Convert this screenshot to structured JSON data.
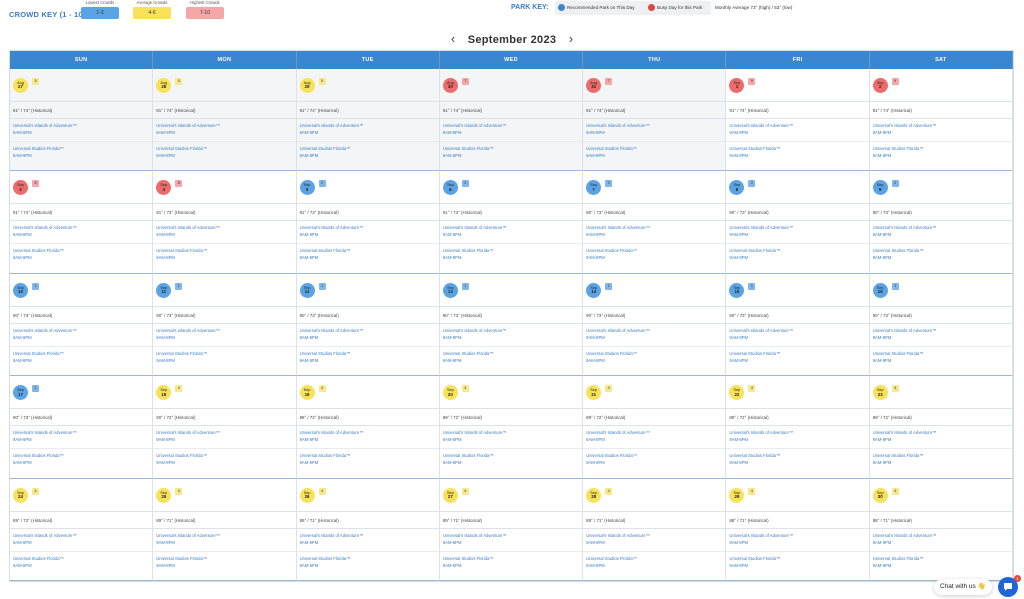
{
  "crowd_key": {
    "title": "CROWD KEY (1 - 10):",
    "items": [
      {
        "label": "Lowest Crowds",
        "range": "1-3",
        "color": "#5aa3e4"
      },
      {
        "label": "Average Crowds",
        "range": "4-6",
        "color": "#f7e25a"
      },
      {
        "label": "Highest Crowds",
        "range": "7-10",
        "color": "#f5a6a6"
      }
    ]
  },
  "park_key": {
    "title": "PARK KEY:",
    "recommended": "Recommended Park on This Day",
    "busy": "Busy Day for this Park",
    "monthly_avg": "Monthly Average 73° (high) / 53° (low)"
  },
  "month_nav": {
    "title": "September 2023",
    "prev": "‹",
    "next": "›"
  },
  "calendar": {
    "days": [
      "SUN",
      "MON",
      "TUE",
      "WED",
      "THU",
      "FRI",
      "SAT"
    ],
    "park_names": [
      "Universal's Islands of Adventure™",
      "Universal Studios Florida™"
    ],
    "weeks": [
      [
        {
          "month": "Aug",
          "day": "27",
          "crowd": "5",
          "level": "avg",
          "weather": "91° / 74° (Historical)",
          "past": true,
          "hours": [
            "9AM-8PM",
            "9AM-8PM"
          ]
        },
        {
          "month": "Aug",
          "day": "28",
          "crowd": "5",
          "level": "avg",
          "weather": "91° / 74° (Historical)",
          "past": true,
          "hours": [
            "9AM-8PM",
            "9AM-8PM"
          ]
        },
        {
          "month": "Aug",
          "day": "29",
          "crowd": "5",
          "level": "avg",
          "weather": "91° / 74° (Historical)",
          "past": true,
          "hours": [
            "9AM-8PM",
            "9AM-8PM"
          ]
        },
        {
          "month": "Aug",
          "day": "30",
          "crowd": "7",
          "level": "high",
          "weather": "91° / 74° (Historical)",
          "past": true,
          "hours": [
            "9AM-8PM",
            "9AM-8PM"
          ]
        },
        {
          "month": "Aug",
          "day": "31",
          "crowd": "7",
          "level": "high",
          "weather": "91° / 74° (Historical)",
          "past": true,
          "hours": [
            "9AM-8PM",
            "9AM-8PM"
          ]
        },
        {
          "month": "Sep",
          "day": "1",
          "crowd": "9",
          "level": "high",
          "weather": "91° / 74° (Historical)",
          "past": false,
          "hours": [
            "9AM-8PM",
            "9AM-8PM"
          ]
        },
        {
          "month": "Sep",
          "day": "2",
          "crowd": "9",
          "level": "high",
          "weather": "91° / 74° (Historical)",
          "past": false,
          "hours": [
            "9AM-8PM",
            "9AM-8PM"
          ]
        }
      ],
      [
        {
          "month": "Sep",
          "day": "3",
          "crowd": "8",
          "level": "high",
          "weather": "91° / 74° (Historical)",
          "past": false,
          "hours": [
            "9AM-8PM",
            "9AM-8PM"
          ]
        },
        {
          "month": "Sep",
          "day": "4",
          "crowd": "8",
          "level": "high",
          "weather": "91° / 73° (Historical)",
          "past": false,
          "hours": [
            "9AM-8PM",
            "9AM-8PM"
          ]
        },
        {
          "month": "Sep",
          "day": "5",
          "crowd": "2",
          "level": "low",
          "weather": "91° / 73° (Historical)",
          "past": false,
          "hours": [
            "9AM-8PM",
            "9AM-8PM"
          ]
        },
        {
          "month": "Sep",
          "day": "6",
          "crowd": "2",
          "level": "low",
          "weather": "91° / 73° (Historical)",
          "past": false,
          "hours": [
            "9AM-8PM",
            "9AM-8PM"
          ]
        },
        {
          "month": "Sep",
          "day": "7",
          "crowd": "2",
          "level": "low",
          "weather": "90° / 73° (Historical)",
          "past": false,
          "hours": [
            "9AM-8PM",
            "9AM-8PM"
          ]
        },
        {
          "month": "Sep",
          "day": "8",
          "crowd": "2",
          "level": "low",
          "weather": "90° / 73° (Historical)",
          "past": false,
          "hours": [
            "9AM-8PM",
            "9AM-8PM"
          ]
        },
        {
          "month": "Sep",
          "day": "9",
          "crowd": "2",
          "level": "low",
          "weather": "90° / 73° (Historical)",
          "past": false,
          "hours": [
            "9AM-8PM",
            "9AM-8PM"
          ]
        }
      ],
      [
        {
          "month": "Sep",
          "day": "10",
          "crowd": "1",
          "level": "low",
          "weather": "90° / 73° (Historical)",
          "past": false,
          "hours": [
            "9AM-8PM",
            "9AM-8PM"
          ]
        },
        {
          "month": "Sep",
          "day": "11",
          "crowd": "1",
          "level": "low",
          "weather": "90° / 73° (Historical)",
          "past": false,
          "hours": [
            "9AM-8PM",
            "9AM-8PM"
          ]
        },
        {
          "month": "Sep",
          "day": "12",
          "crowd": "1",
          "level": "low",
          "weather": "90° / 73° (Historical)",
          "past": false,
          "hours": [
            "9AM-8PM",
            "9AM-8PM"
          ]
        },
        {
          "month": "Sep",
          "day": "13",
          "crowd": "1",
          "level": "low",
          "weather": "90° / 73° (Historical)",
          "past": false,
          "hours": [
            "9AM-8PM",
            "9AM-8PM"
          ]
        },
        {
          "month": "Sep",
          "day": "14",
          "crowd": "1",
          "level": "low",
          "weather": "90° / 73° (Historical)",
          "past": false,
          "hours": [
            "9AM-8PM",
            "9AM-8PM"
          ]
        },
        {
          "month": "Sep",
          "day": "15",
          "crowd": "1",
          "level": "low",
          "weather": "90° / 73° (Historical)",
          "past": false,
          "hours": [
            "9AM-8PM",
            "9AM-8PM"
          ]
        },
        {
          "month": "Sep",
          "day": "16",
          "crowd": "1",
          "level": "low",
          "weather": "90° / 73° (Historical)",
          "past": false,
          "hours": [
            "9AM-8PM",
            "9AM-8PM"
          ]
        }
      ],
      [
        {
          "month": "Sep",
          "day": "17",
          "crowd": "1",
          "level": "low",
          "weather": "90° / 73° (Historical)",
          "past": false,
          "hours": [
            "9AM-8PM",
            "9AM-8PM"
          ]
        },
        {
          "month": "Sep",
          "day": "18",
          "crowd": "4",
          "level": "avg",
          "weather": "90° / 72° (Historical)",
          "past": false,
          "hours": [
            "9AM-8PM",
            "9AM-8PM"
          ]
        },
        {
          "month": "Sep",
          "day": "19",
          "crowd": "4",
          "level": "avg",
          "weather": "89° / 72° (Historical)",
          "past": false,
          "hours": [
            "9AM-8PM",
            "9AM-8PM"
          ]
        },
        {
          "month": "Sep",
          "day": "20",
          "crowd": "4",
          "level": "avg",
          "weather": "89° / 72° (Historical)",
          "past": false,
          "hours": [
            "9AM-8PM",
            "9AM-8PM"
          ]
        },
        {
          "month": "Sep",
          "day": "21",
          "crowd": "4",
          "level": "avg",
          "weather": "89° / 72° (Historical)",
          "past": false,
          "hours": [
            "9AM-8PM",
            "9AM-8PM"
          ]
        },
        {
          "month": "Sep",
          "day": "22",
          "crowd": "4",
          "level": "avg",
          "weather": "89° / 72° (Historical)",
          "past": false,
          "hours": [
            "9AM-8PM",
            "9AM-8PM"
          ]
        },
        {
          "month": "Sep",
          "day": "23",
          "crowd": "4",
          "level": "avg",
          "weather": "89° / 72° (Historical)",
          "past": false,
          "hours": [
            "9AM-8PM",
            "9AM-8PM"
          ]
        }
      ],
      [
        {
          "month": "Sep",
          "day": "24",
          "crowd": "4",
          "level": "avg",
          "weather": "89° / 72° (Historical)",
          "past": false,
          "hours": [
            "9AM-8PM",
            "9AM-8PM"
          ]
        },
        {
          "month": "Sep",
          "day": "25",
          "crowd": "4",
          "level": "avg",
          "weather": "89° / 71° (Historical)",
          "past": false,
          "hours": [
            "9AM-8PM",
            "9AM-8PM"
          ]
        },
        {
          "month": "Sep",
          "day": "26",
          "crowd": "4",
          "level": "avg",
          "weather": "89° / 71° (Historical)",
          "past": false,
          "hours": [
            "9AM-8PM",
            "9AM-8PM"
          ]
        },
        {
          "month": "Sep",
          "day": "27",
          "crowd": "4",
          "level": "avg",
          "weather": "89° / 71° (Historical)",
          "past": false,
          "hours": [
            "9AM-8PM",
            "9AM-8PM"
          ]
        },
        {
          "month": "Sep",
          "day": "28",
          "crowd": "4",
          "level": "avg",
          "weather": "88° / 71° (Historical)",
          "past": false,
          "hours": [
            "9AM-8PM",
            "9AM-8PM"
          ]
        },
        {
          "month": "Sep",
          "day": "29",
          "crowd": "4",
          "level": "avg",
          "weather": "88° / 71° (Historical)",
          "past": false,
          "hours": [
            "9AM-8PM",
            "9AM-8PM"
          ]
        },
        {
          "month": "Sep",
          "day": "30",
          "crowd": "4",
          "level": "avg",
          "weather": "88° / 71° (Historical)",
          "past": false,
          "hours": [
            "9AM-8PM",
            "9AM-8PM"
          ]
        }
      ]
    ]
  },
  "chat": {
    "label": "Chat with us 👋",
    "badge": "1"
  }
}
